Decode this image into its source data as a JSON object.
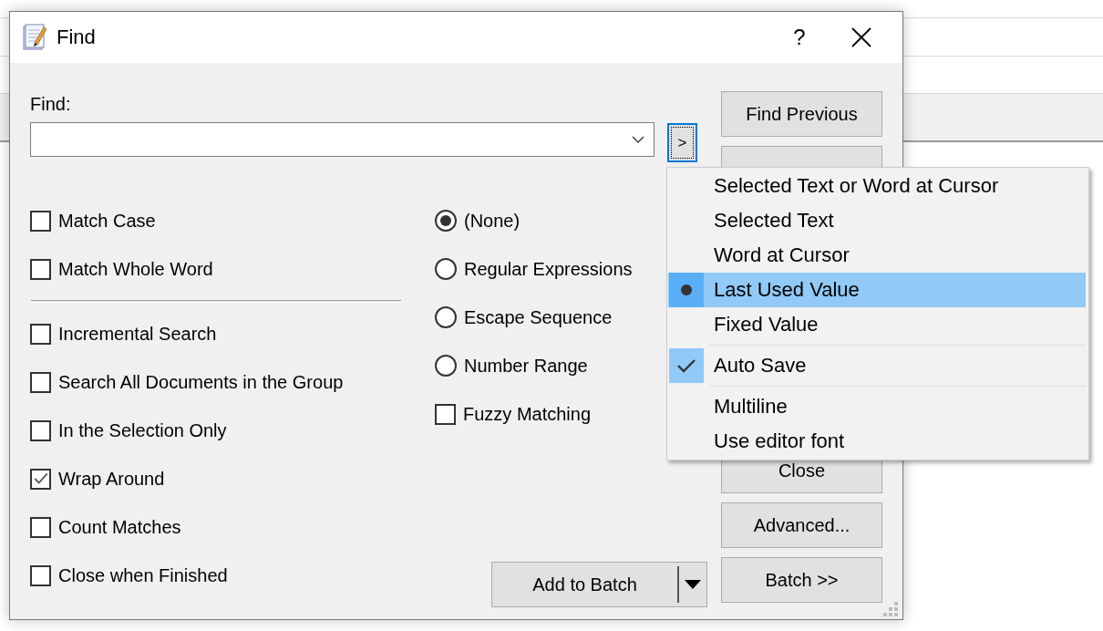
{
  "window": {
    "title": "Find",
    "help": "?"
  },
  "find": {
    "label": "Find:",
    "toggle": ">"
  },
  "left_options": [
    [
      {
        "label": "Match Case",
        "checked": false
      },
      {
        "label": "Match Whole Word",
        "checked": false
      }
    ],
    [
      {
        "label": "Incremental Search",
        "checked": false
      },
      {
        "label": "Search All Documents in the Group",
        "checked": false
      },
      {
        "label": "In the Selection Only",
        "checked": false
      },
      {
        "label": "Wrap Around",
        "checked": true
      },
      {
        "label": "Count Matches",
        "checked": false
      },
      {
        "label": "Close when Finished",
        "checked": false
      }
    ]
  ],
  "right_options": [
    {
      "kind": "radio",
      "label": "(None)",
      "selected": true
    },
    {
      "kind": "radio",
      "label": "Regular Expressions",
      "selected": false
    },
    {
      "kind": "radio",
      "label": "Escape Sequence",
      "selected": false
    },
    {
      "kind": "radio",
      "label": "Number Range",
      "selected": false
    },
    {
      "kind": "checkbox",
      "label": "Fuzzy Matching",
      "checked": false
    }
  ],
  "add_to_batch": "Add to Batch",
  "buttons": {
    "top": [
      "Find Previous"
    ],
    "bottom": [
      "Close",
      "Advanced...",
      "Batch >>"
    ]
  },
  "menu": {
    "groups": [
      [
        {
          "kind": "radio",
          "label": "Selected Text or Word at Cursor",
          "selected": false,
          "highlighted": false
        },
        {
          "kind": "radio",
          "label": "Selected Text",
          "selected": false,
          "highlighted": false
        },
        {
          "kind": "radio",
          "label": "Word at Cursor",
          "selected": false,
          "highlighted": false
        },
        {
          "kind": "radio",
          "label": "Last Used Value",
          "selected": true,
          "highlighted": true
        },
        {
          "kind": "radio",
          "label": "Fixed Value",
          "selected": false,
          "highlighted": false
        }
      ],
      [
        {
          "kind": "check",
          "label": "Auto Save",
          "checked": true,
          "highlighted": false
        }
      ],
      [
        {
          "kind": "check",
          "label": "Multiline",
          "checked": false,
          "highlighted": false
        },
        {
          "kind": "check",
          "label": "Use editor font",
          "checked": false,
          "highlighted": false
        }
      ]
    ]
  }
}
